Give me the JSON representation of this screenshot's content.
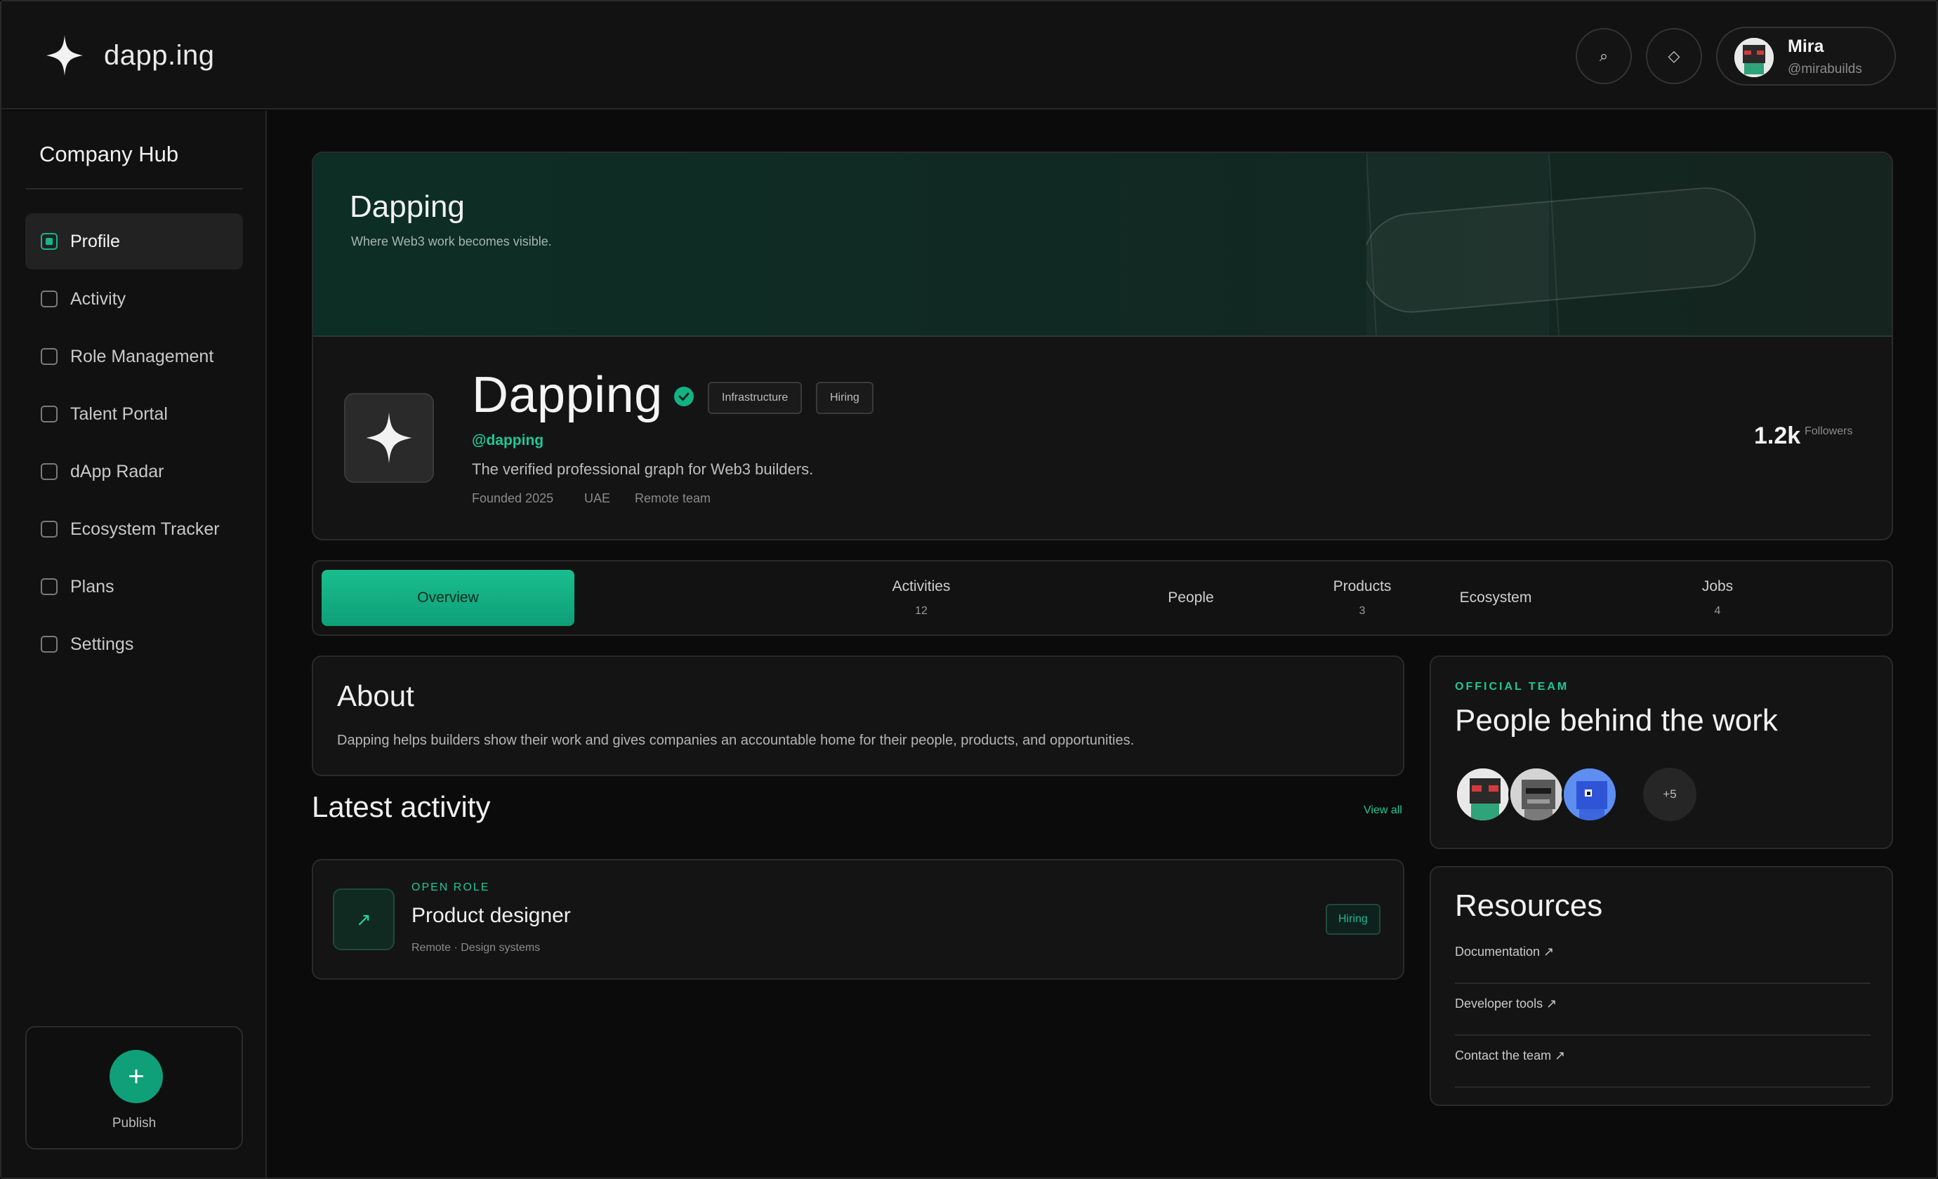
{
  "header": {
    "brand": "dapp.ing",
    "search_icon_glyph": "⌕",
    "diamond_icon_glyph": "◇",
    "user": {
      "name": "Mira",
      "handle": "@mirabuilds"
    }
  },
  "sidebar": {
    "title": "Company Hub",
    "items": [
      {
        "label": "Profile",
        "active": true
      },
      {
        "label": "Activity"
      },
      {
        "label": "Role Management"
      },
      {
        "label": "Talent Portal"
      },
      {
        "label": "dApp Radar"
      },
      {
        "label": "Ecosystem Tracker"
      },
      {
        "label": "Plans"
      },
      {
        "label": "Settings"
      }
    ],
    "publish": {
      "icon_glyph": "+",
      "label": "Publish"
    }
  },
  "hero": {
    "banner_title": "Dapping",
    "banner_subtitle": "Where Web3 work becomes visible.",
    "name": "Dapping",
    "tags": [
      "Infrastructure",
      "Hiring"
    ],
    "handle": "@dapping",
    "tagline": "The verified professional graph for Web3 builders.",
    "meta": [
      "Founded 2025",
      "UAE",
      "Remote team"
    ],
    "followers": {
      "count": "1.2k",
      "label": "Followers"
    }
  },
  "tabs": [
    {
      "label": "Overview",
      "count": ""
    },
    {
      "label": "Activities",
      "count": "12"
    },
    {
      "label": "People",
      "count": ""
    },
    {
      "label": "Products",
      "count": "3"
    },
    {
      "label": "Ecosystem",
      "count": ""
    },
    {
      "label": "Jobs",
      "count": "4"
    }
  ],
  "about": {
    "title": "About",
    "text": "Dapping helps builders show their work and gives companies an accountable home for their people, products, and opportunities."
  },
  "activity": {
    "title": "Latest activity",
    "view_all": "View all",
    "items": [
      {
        "eyebrow": "OPEN ROLE",
        "title": "Product designer",
        "meta": "Remote · Design systems",
        "badge": "Hiring",
        "icon_glyph": "↗"
      }
    ]
  },
  "team": {
    "eyebrow": "OFFICIAL TEAM",
    "title": "People behind the work",
    "more": "+5"
  },
  "resources": {
    "title": "Resources",
    "links": [
      "Documentation ↗",
      "Developer tools ↗",
      "Contact the team ↗"
    ]
  },
  "colors": {
    "accent": "#1fc796",
    "accent_dark": "#0fa079",
    "background": "#0b0b0b",
    "card": "#141414",
    "border": "#2a2a2a"
  }
}
